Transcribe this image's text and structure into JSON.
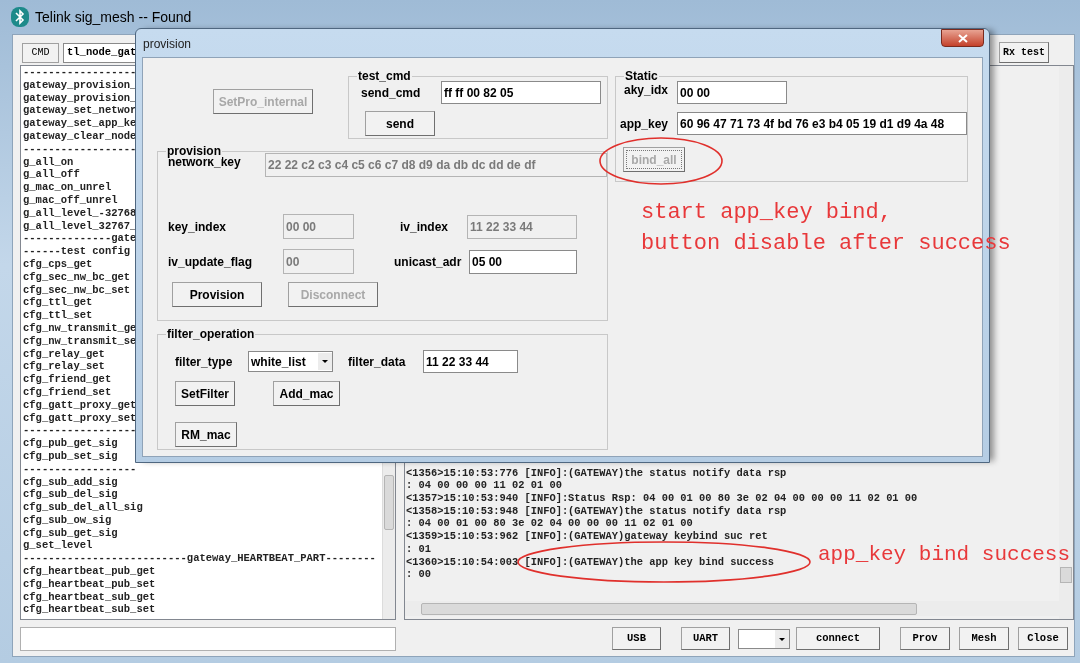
{
  "main_window": {
    "title": "Telink sig_mesh -- Found",
    "cmd_tab": "CMD",
    "command_field": "tl_node_gat",
    "rx_test_button": "Rx test",
    "command_list": [
      "------------------",
      "gateway_provision_",
      "gateway_provision_",
      "gateway_set_networ",
      "gateway_set_app_ke",
      "gateway_clear_node",
      "------------------",
      "g_all_on",
      "g_all_off",
      "g_mac_on_unrel",
      "g_mac_off_unrel",
      "g_all_level_-32768",
      "g_all_level_32767_",
      "--------------gate",
      "------test config",
      "cfg_cps_get",
      "cfg_sec_nw_bc_get",
      "cfg_sec_nw_bc_set",
      "cfg_ttl_get",
      "cfg_ttl_set",
      "cfg_nw_transmit_ge",
      "cfg_nw_transmit_se",
      "cfg_relay_get",
      "cfg_relay_set",
      "cfg_friend_get",
      "cfg_friend_set",
      "cfg_gatt_proxy_get",
      "cfg_gatt_proxy_set",
      "------------------",
      "cfg_pub_get_sig",
      "cfg_pub_set_sig",
      "------------------",
      "cfg_sub_add_sig",
      "cfg_sub_del_sig",
      "cfg_sub_del_all_sig",
      "cfg_sub_ow_sig",
      "cfg_sub_get_sig",
      "g_set_level",
      "--------------------------gateway_HEARTBEAT_PART--------",
      "cfg_heartbeat_pub_get",
      "cfg_heartbeat_pub_set",
      "cfg_heartbeat_sub_get",
      "cfg_heartbeat_sub_set"
    ],
    "log": [
      "<1356>15:10:53:776 [INFO]:(GATEWAY)the status notify data rsp",
      ": 04 00 00 00 11 02 01 00",
      "<1357>15:10:53:940 [INFO]:Status Rsp: 04 00 01 00 80 3e 02 04 00 00 00 11 02 01 00",
      "<1358>15:10:53:948 [INFO]:(GATEWAY)the status notify data rsp",
      ": 04 00 01 00 80 3e 02 04 00 00 00 11 02 01 00",
      "<1359>15:10:53:962 [INFO]:(GATEWAY)gateway keybind suc ret",
      ": 01",
      "<1360>15:10:54:003 [INFO]:(GATEWAY)the app key bind success",
      ": 00"
    ],
    "bottom_left_buttons": [
      "USB",
      "UART"
    ],
    "bottom_right_buttons": [
      "connect",
      "Prov",
      "Mesh",
      "Close"
    ]
  },
  "dialog": {
    "title": "provision",
    "setpro_button": {
      "label": "SetPro_internal",
      "disabled": true
    },
    "test_cmd": {
      "title": "test_cmd",
      "send_cmd": {
        "label": "send_cmd",
        "value": "ff ff 00 82 05",
        "disabled": false
      },
      "send_button": {
        "label": "send",
        "disabled": false
      }
    },
    "static": {
      "title": "Static",
      "aky_idx": {
        "label": "aky_idx",
        "value": "00 00",
        "disabled": false
      },
      "app_key": {
        "label": "app_key",
        "value": "60 96 47 71 73 4f bd 76 e3 b4 05 19 d1 d9 4a 48",
        "disabled": false
      },
      "bind_all": {
        "label": "bind_all",
        "disabled": true
      }
    },
    "provision": {
      "title": "provision",
      "network_key": {
        "label": "network_key",
        "value": "22 22 c2 c3 c4 c5 c6 c7 d8 d9 da db dc dd de df",
        "disabled": true
      },
      "key_index": {
        "label": "key_index",
        "value": "00 00",
        "disabled": true
      },
      "iv_index": {
        "label": "iv_index",
        "value": "11 22 33 44",
        "disabled": true
      },
      "iv_update_flag": {
        "label": "iv_update_flag",
        "value": "00",
        "disabled": true
      },
      "unicast_adr": {
        "label": "unicast_adr",
        "value": "05 00",
        "disabled": false
      },
      "provision_button": {
        "label": "Provision",
        "disabled": false
      },
      "disconnect_button": {
        "label": "Disconnect",
        "disabled": true
      }
    },
    "filter_operation": {
      "title": "filter_operation",
      "filter_type": {
        "label": "filter_type",
        "value": "white_list"
      },
      "filter_data": {
        "label": "filter_data",
        "value": "11 22 33 44",
        "disabled": false
      },
      "setfilter_button": {
        "label": "SetFilter",
        "disabled": false
      },
      "add_mac_button": {
        "label": "Add_mac",
        "disabled": false
      },
      "rm_mac_button": {
        "label": "RM_mac",
        "disabled": false
      }
    }
  },
  "annotations": {
    "bind_note": [
      "start app_key bind,",
      "button disable after success"
    ],
    "log_note": "app_key bind success"
  }
}
